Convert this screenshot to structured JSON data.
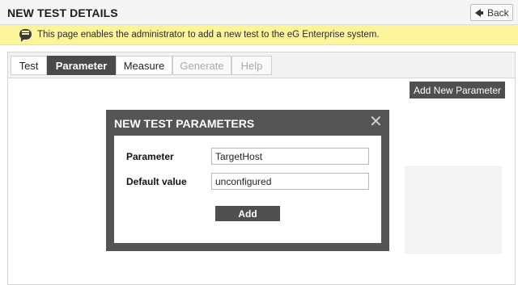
{
  "header": {
    "title": "NEW TEST DETAILS",
    "back_label": "Back"
  },
  "info": {
    "message": "This page enables the administrator to add a new test to the eG Enterprise system.",
    "icon": "chat-bubble-icon",
    "background_color": "#fbf49a"
  },
  "tabs": [
    {
      "label": "Test",
      "state": "normal"
    },
    {
      "label": "Parameter",
      "state": "active"
    },
    {
      "label": "Measure",
      "state": "normal"
    },
    {
      "label": "Generate",
      "state": "disabled"
    },
    {
      "label": "Help",
      "state": "disabled"
    }
  ],
  "toolbar": {
    "add_new_parameter_label": "Add New Parameter"
  },
  "modal": {
    "title": "NEW TEST PARAMETERS",
    "close_icon": "close-icon",
    "fields": [
      {
        "label": "Parameter",
        "value": "TargetHost"
      },
      {
        "label": "Default value",
        "value": "unconfigured"
      }
    ],
    "add_label": "Add"
  },
  "colors": {
    "dark_accent": "#4a4a4a",
    "modal_frame": "#555555"
  }
}
